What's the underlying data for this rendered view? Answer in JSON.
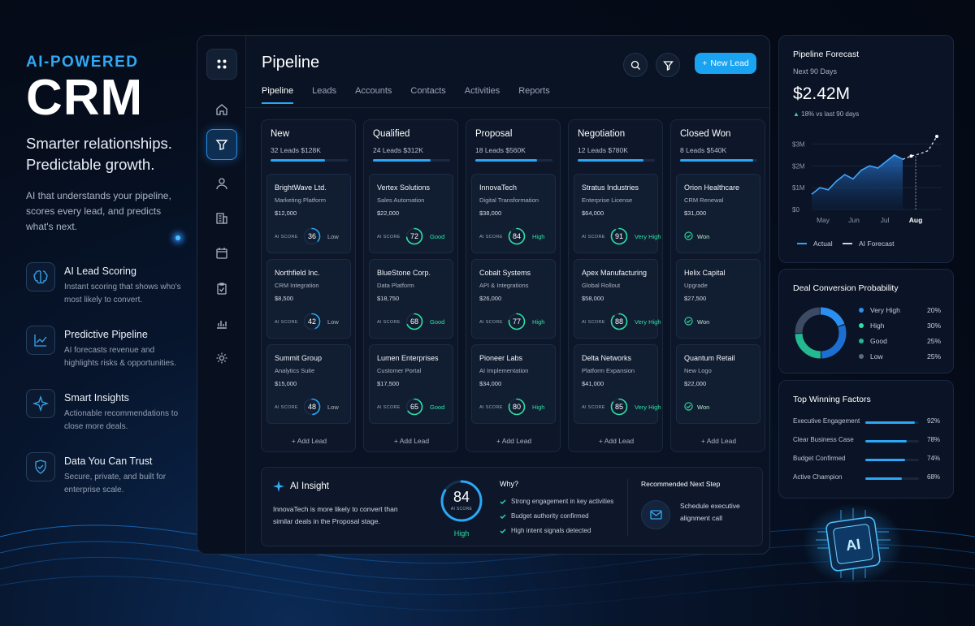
{
  "hero": {
    "kicker": "AI-POWERED",
    "title": "CRM",
    "subtitle_line1": "Smarter relationships.",
    "subtitle_line2": "Predictable growth.",
    "description": "AI that understands your pipeline, scores every lead, and predicts what's next."
  },
  "features": [
    {
      "title": "AI Lead Scoring",
      "desc": "Instant scoring that shows who's most likely to convert.",
      "icon": "brain-icon"
    },
    {
      "title": "Predictive Pipeline",
      "desc": "AI forecasts revenue and highlights risks & opportunities.",
      "icon": "trend-chart-icon"
    },
    {
      "title": "Smart Insights",
      "desc": "Actionable recommendations to close more deals.",
      "icon": "sparkle-icon"
    },
    {
      "title": "Data You Can Trust",
      "desc": "Secure, private, and built for enterprise scale.",
      "icon": "shield-icon"
    }
  ],
  "app": {
    "title": "Pipeline",
    "new_lead_label": "New Lead",
    "new_lead_plus": "+",
    "tabs": [
      "Pipeline",
      "Leads",
      "Accounts",
      "Contacts",
      "Activities",
      "Reports"
    ],
    "active_tab": "Pipeline",
    "rail_icons": [
      "apps-icon",
      "home-icon",
      "funnel-icon",
      "user-icon",
      "building-icon",
      "calendar-icon",
      "clipboard-check-icon",
      "bar-chart-icon",
      "settings-icon"
    ]
  },
  "pipeline": {
    "ai_score_label": "AI SCORE",
    "add_lead_label": "+ Add Lead",
    "columns": [
      {
        "name": "New",
        "meta": "32 Leads   $128K",
        "progress": 0.7,
        "cards": [
          {
            "company": "BrightWave Ltd.",
            "sub": "Marketing Platform",
            "amount": "$12,000",
            "score": 36,
            "label": "Low"
          },
          {
            "company": "Northfield Inc.",
            "sub": "CRM Integration",
            "amount": "$8,500",
            "score": 42,
            "label": "Low"
          },
          {
            "company": "Summit Group",
            "sub": "Analytics Suite",
            "amount": "$15,000",
            "score": 48,
            "label": "Low"
          }
        ]
      },
      {
        "name": "Qualified",
        "meta": "24 Leads   $312K",
        "progress": 0.75,
        "cards": [
          {
            "company": "Vertex Solutions",
            "sub": "Sales Automation",
            "amount": "$22,000",
            "score": 72,
            "label": "Good"
          },
          {
            "company": "BlueStone Corp.",
            "sub": "Data Platform",
            "amount": "$18,750",
            "score": 68,
            "label": "Good"
          },
          {
            "company": "Lumen Enterprises",
            "sub": "Customer Portal",
            "amount": "$17,500",
            "score": 65,
            "label": "Good"
          }
        ]
      },
      {
        "name": "Proposal",
        "meta": "18 Leads   $560K",
        "progress": 0.8,
        "cards": [
          {
            "company": "InnovaTech",
            "sub": "Digital Transformation",
            "amount": "$38,000",
            "score": 84,
            "label": "High"
          },
          {
            "company": "Cobalt Systems",
            "sub": "API & Integrations",
            "amount": "$26,000",
            "score": 77,
            "label": "High"
          },
          {
            "company": "Pioneer Labs",
            "sub": "AI Implementation",
            "amount": "$34,000",
            "score": 80,
            "label": "High"
          }
        ]
      },
      {
        "name": "Negotiation",
        "meta": "12 Leads   $780K",
        "progress": 0.85,
        "cards": [
          {
            "company": "Stratus Industries",
            "sub": "Enterprise License",
            "amount": "$64,000",
            "score": 91,
            "label": "Very High"
          },
          {
            "company": "Apex Manufacturing",
            "sub": "Global Rollout",
            "amount": "$58,000",
            "score": 88,
            "label": "Very High"
          },
          {
            "company": "Delta Networks",
            "sub": "Platform Expansion",
            "amount": "$41,000",
            "score": 85,
            "label": "Very High"
          }
        ]
      },
      {
        "name": "Closed Won",
        "meta": "8 Leads   $540K",
        "progress": 0.95,
        "cards": [
          {
            "company": "Orion Healthcare",
            "sub": "CRM Renewal",
            "amount": "$31,000",
            "won": "Won"
          },
          {
            "company": "Helix Capital",
            "sub": "Upgrade",
            "amount": "$27,500",
            "won": "Won"
          },
          {
            "company": "Quantum Retail",
            "sub": "New Logo",
            "amount": "$22,000",
            "won": "Won"
          }
        ]
      }
    ]
  },
  "insight": {
    "title": "AI Insight",
    "text": "InnovaTech is more likely to convert than similar deals in the Proposal stage.",
    "score": "84",
    "score_sub": "AI SCORE",
    "score_label": "High",
    "score_value": 84,
    "why_title": "Why?",
    "why_items": [
      "Strong engagement in key activities",
      "Budget authority confirmed",
      "High intent signals detected"
    ],
    "next_title": "Recommended Next Step",
    "next_text": "Schedule executive alignment call"
  },
  "forecast": {
    "title": "Pipeline Forecast",
    "sub": "Next 90 Days",
    "amount": "$2.42M",
    "change": "18% vs last 90 days",
    "change_arrow": "▲",
    "legend_actual": "Actual",
    "legend_forecast": "AI Forecast"
  },
  "chart_data": {
    "type": "area",
    "x_ticks": [
      "May",
      "Jun",
      "Jul",
      "Aug"
    ],
    "y_ticks": [
      "$3M",
      "$2M",
      "$1M",
      "$0"
    ],
    "ylim": [
      0,
      3.5
    ],
    "series": [
      {
        "name": "Actual",
        "values": [
          0.7,
          1.0,
          0.9,
          1.3,
          1.6,
          1.4,
          1.8,
          2.0,
          1.9,
          2.2,
          2.5,
          2.3
        ]
      },
      {
        "name": "AI Forecast",
        "values": [
          2.3,
          2.45,
          2.55,
          2.7,
          3.35
        ]
      }
    ]
  },
  "conversion": {
    "title": "Deal Conversion Probability",
    "items": [
      {
        "label": "Very High",
        "pct": "20%",
        "value": 20,
        "color": "#2b8ff0"
      },
      {
        "label": "High",
        "pct": "30%",
        "value": 30,
        "color": "#1c6fd0"
      },
      {
        "label": "Good",
        "pct": "25%",
        "value": 25,
        "color": "#23b890"
      },
      {
        "label": "Low",
        "pct": "25%",
        "value": 25,
        "color": "#3c4b63"
      }
    ]
  },
  "factors": {
    "title": "Top Winning Factors",
    "items": [
      {
        "label": "Executive Engagement",
        "pct": "92%",
        "value": 92
      },
      {
        "label": "Clear Business Case",
        "pct": "78%",
        "value": 78
      },
      {
        "label": "Budget Confirmed",
        "pct": "74%",
        "value": 74
      },
      {
        "label": "Active Champion",
        "pct": "68%",
        "value": 68
      }
    ]
  },
  "chip_label": "AI"
}
